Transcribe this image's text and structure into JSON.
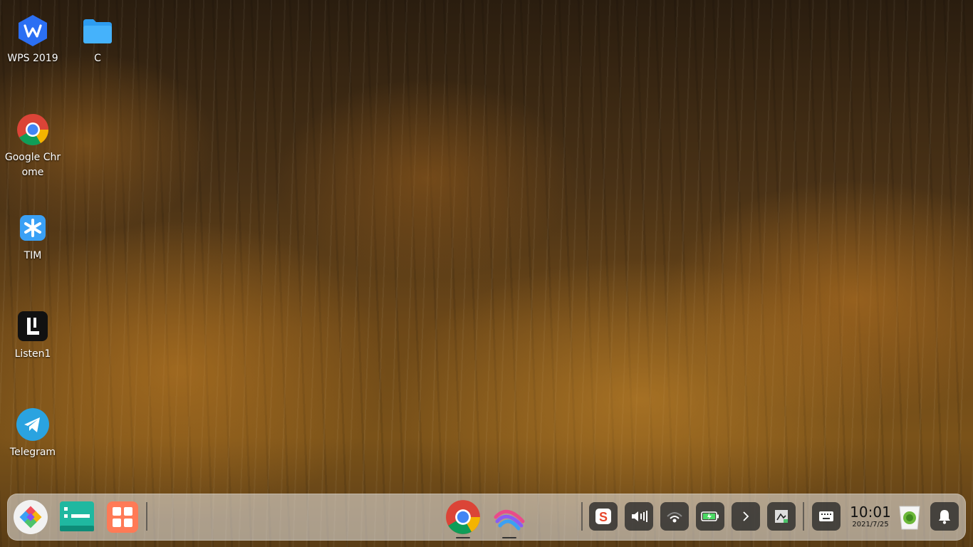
{
  "desktop": {
    "icons": [
      {
        "label": "WPS 2019",
        "icon": "wps-icon"
      },
      {
        "label": "C",
        "icon": "folder-icon"
      },
      {
        "label": "Google Chrome",
        "icon": "chrome-icon"
      },
      {
        "label": "TIM",
        "icon": "tim-icon"
      },
      {
        "label": "Listen1",
        "icon": "listen1-icon"
      },
      {
        "label": "Telegram",
        "icon": "telegram-icon"
      }
    ]
  },
  "dock": {
    "left_items": [
      "launcher-icon",
      "multitask-view-icon",
      "app-store-icon"
    ],
    "apps": [
      "chrome-icon",
      "browser-app-icon"
    ],
    "tray": [
      "sogou-input-icon",
      "volume-icon",
      "network-icon",
      "battery-icon",
      "expand-tray-icon",
      "screenshot-icon",
      "keyboard-icon"
    ],
    "clock": {
      "time": "10:01",
      "date": "2021/7/25"
    },
    "right_items": [
      "trash-icon",
      "notification-bell-icon"
    ]
  },
  "colors": {
    "wps_blue": "#2b6ff3",
    "folder_blue": "#2d9cf0",
    "tim_blue": "#3aa0f5",
    "telegram_blue": "#2aa3e0",
    "dock_bg": "rgba(235,235,235,0.55)"
  }
}
